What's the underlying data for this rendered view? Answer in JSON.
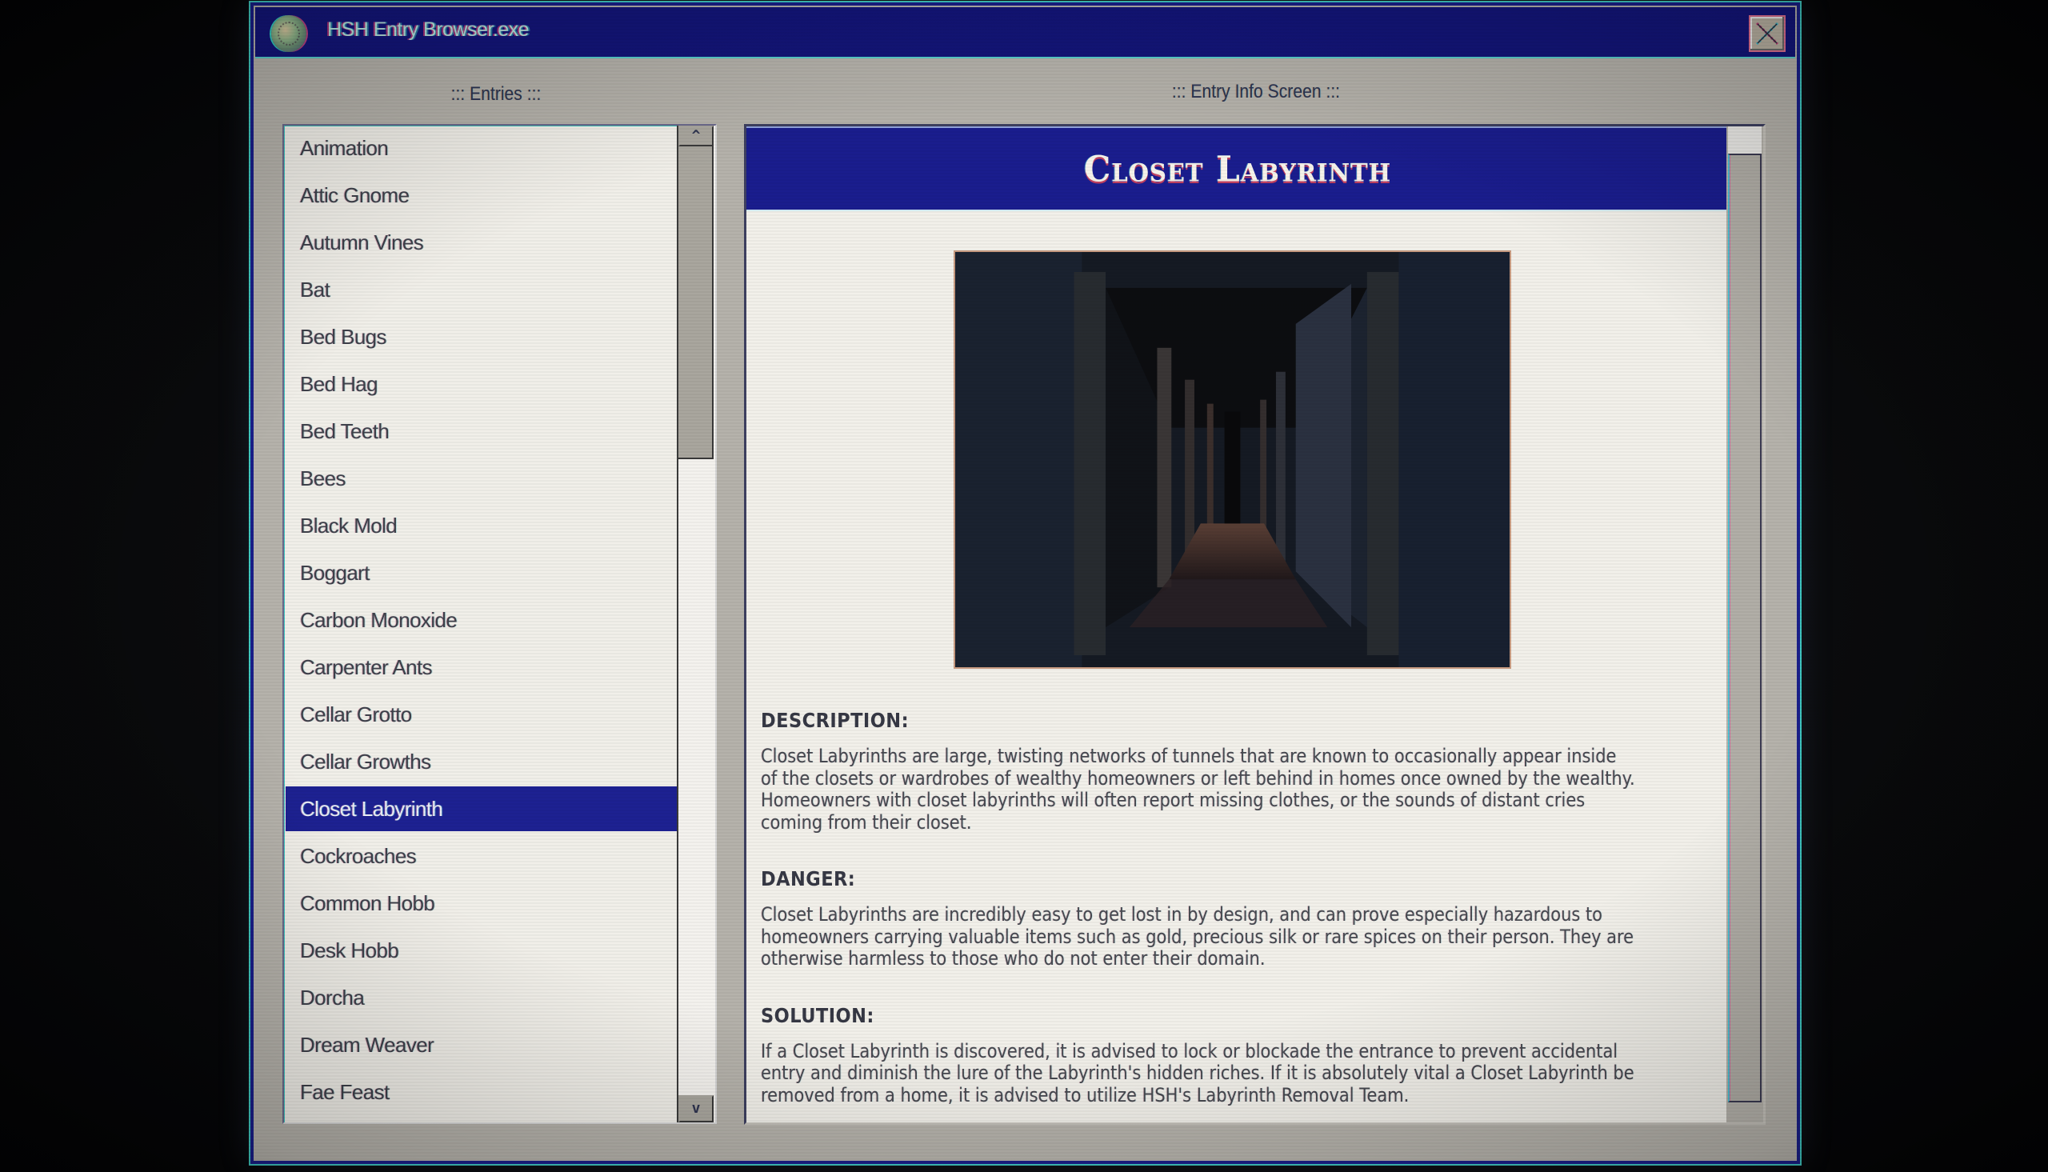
{
  "window": {
    "title": "HSH Entry Browser.exe",
    "app_icon": "globe-brain-icon",
    "close_icon": "close-x-icon"
  },
  "entries_panel": {
    "label": "::: Entries :::",
    "scroll_up_label": "^",
    "scroll_down_label": "v",
    "scroll_thumb": {
      "start_fraction": 0,
      "visible_fraction": 0.33
    },
    "selected_index": 14,
    "items": [
      "Animation",
      "Attic Gnome",
      "Autumn Vines",
      "Bat",
      "Bed Bugs",
      "Bed Hag",
      "Bed Teeth",
      "Bees",
      "Black Mold",
      "Boggart",
      "Carbon Monoxide",
      "Carpenter Ants",
      "Cellar Grotto",
      "Cellar Growths",
      "Closet Labyrinth",
      "Cockroaches",
      "Common Hobb",
      "Desk Hobb",
      "Dorcha",
      "Dream Weaver",
      "Fae Feast"
    ]
  },
  "info_panel": {
    "label": "::: Entry Info Screen :::",
    "scroll_thumb": {
      "start_fraction": 0.02,
      "visible_fraction": 0.98
    },
    "entry": {
      "title": "Closet Labyrinth",
      "image_alt": "Dark corridor of closet doors receding into the distance with a wooden floor",
      "sections": [
        {
          "heading": "DESCRIPTION:",
          "lines": [
            "Closet Labyrinths are large, twisting networks of tunnels that are known to occasionally appear inside",
            "of the closets or wardrobes of wealthy homeowners or left behind in homes once owned by the wealthy.",
            "Homeowners with closet labyrinths will often report missing clothes, or the sounds of distant cries",
            "coming from their closet."
          ]
        },
        {
          "heading": "DANGER:",
          "lines": [
            "Closet Labyrinths are incredibly easy to get lost in by design, and can prove especially hazardous to",
            "homeowners carrying valuable items such as gold, precious silk or rare spices on their person. They are",
            "otherwise harmless to those who do not enter their domain."
          ]
        },
        {
          "heading": "SOLUTION:",
          "lines": [
            "If a Closet Labyrinth is discovered, it is advised to lock or blockade the entrance to prevent accidental",
            "entry and diminish the lure of the Labyrinth's hidden riches. If it is absolutely vital a Closet Labyrinth be",
            "removed from a home, it is advised to utilize HSH's Labyrinth Removal Team."
          ]
        }
      ]
    }
  },
  "colors": {
    "titlebar": "#13157a",
    "selection": "#1d2192",
    "window_face": "#b5b2ab",
    "list_bg": "#f1efe9",
    "list_text": "#3e404a",
    "header_text": "#f6f3ea"
  }
}
